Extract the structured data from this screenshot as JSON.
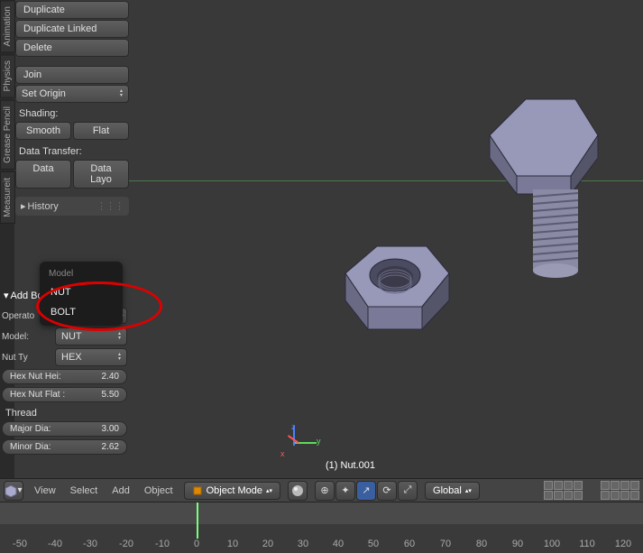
{
  "side_tabs": [
    "Animation",
    "Physics",
    "Grease Pencil",
    "Measureit"
  ],
  "tools": {
    "duplicate": "Duplicate",
    "duplicate_linked": "Duplicate Linked",
    "delete": "Delete",
    "join": "Join",
    "set_origin": "Set Origin"
  },
  "shading": {
    "label": "Shading:",
    "smooth": "Smooth",
    "flat": "Flat"
  },
  "data_transfer": {
    "label": "Data Transfer:",
    "data": "Data",
    "layout": "Data Layo"
  },
  "history_label": "History",
  "popup": {
    "header": "Model",
    "items": [
      "NUT",
      "BOLT"
    ]
  },
  "operator": {
    "panel_title": "Add Bolt",
    "presets_label": "Operato",
    "model_label": "Model:",
    "model_value": "NUT",
    "nut_type_label": "Nut Ty",
    "nut_type_value": "HEX",
    "hex_nut_height": {
      "label": "Hex Nut Hei:",
      "value": "2.40"
    },
    "hex_nut_flat": {
      "label": "Hex Nut Flat :",
      "value": "5.50"
    },
    "thread_label": "Thread",
    "major_dia": {
      "label": "Major Dia:",
      "value": "3.00"
    },
    "minor_dia": {
      "label": "Minor Dia:",
      "value": "2.62"
    }
  },
  "viewport": {
    "object_name": "(1) Nut.001",
    "axes": {
      "x": "x",
      "y": "y",
      "z": "z"
    }
  },
  "header": {
    "menus": [
      "View",
      "Select",
      "Add",
      "Object"
    ],
    "mode": "Object Mode",
    "orientation": "Global"
  },
  "timeline": {
    "ticks": [
      "-50",
      "-40",
      "-30",
      "-20",
      "-10",
      "0",
      "10",
      "20",
      "30",
      "40",
      "50",
      "60",
      "70",
      "80",
      "90",
      "100",
      "110",
      "120"
    ]
  }
}
